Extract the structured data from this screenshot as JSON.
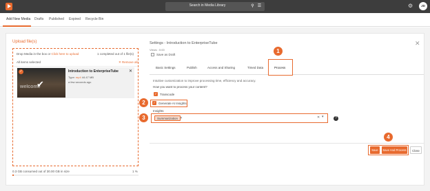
{
  "topbar": {
    "search_placeholder": "Search in Media Library",
    "avatar_initials": "JD"
  },
  "nav": {
    "tabs": [
      {
        "label": "Add New Media"
      },
      {
        "label": "Drafts"
      },
      {
        "label": "Published"
      },
      {
        "label": "Expired"
      },
      {
        "label": "Recycle Bin"
      }
    ]
  },
  "upload": {
    "title": "Upload file(s)",
    "drop_prefix": "Drop Media in the box or",
    "drop_link": "Click here to upload",
    "completed": "1 completed out of 1 file(s)",
    "all_selected": "All items selected",
    "remove_all": "Remove all",
    "file": {
      "title": "Introduction to EnterpriseTube",
      "type_label": "Type:",
      "type_value": "mp4",
      "size": "44.47 MB",
      "time": "a few seconds ago",
      "thumb_text": "welcome"
    },
    "storage": "0.3 GB consumed out of 30.00 GB in size",
    "storage_pct": "1 %",
    "storage_fraction": 0.01
  },
  "settings": {
    "title": "Settings - Introduction to EnterpriseTube",
    "views": "Views : 0:00",
    "save_draft": "Save as Draft",
    "tabs": [
      {
        "label": "Basic Settings"
      },
      {
        "label": "Publish"
      },
      {
        "label": "Access and Sharing"
      },
      {
        "label": "Timed Data"
      },
      {
        "label": "Process"
      }
    ],
    "description": "Intuitive customization to improve processing time, efficiency and accuracy.",
    "question": "How you want to process your content?",
    "transcode": "Transcode",
    "ai_insights": "Generate AI Insights",
    "insights_label": "Insights",
    "insight_chip": "Summarization"
  },
  "buttons": {
    "save": "Save",
    "save_process": "Save And Process",
    "close": "Close"
  },
  "markers": [
    "1",
    "2",
    "3",
    "4"
  ],
  "colors": {
    "accent": "#e86a2e",
    "topbar": "#3d3d3d"
  }
}
